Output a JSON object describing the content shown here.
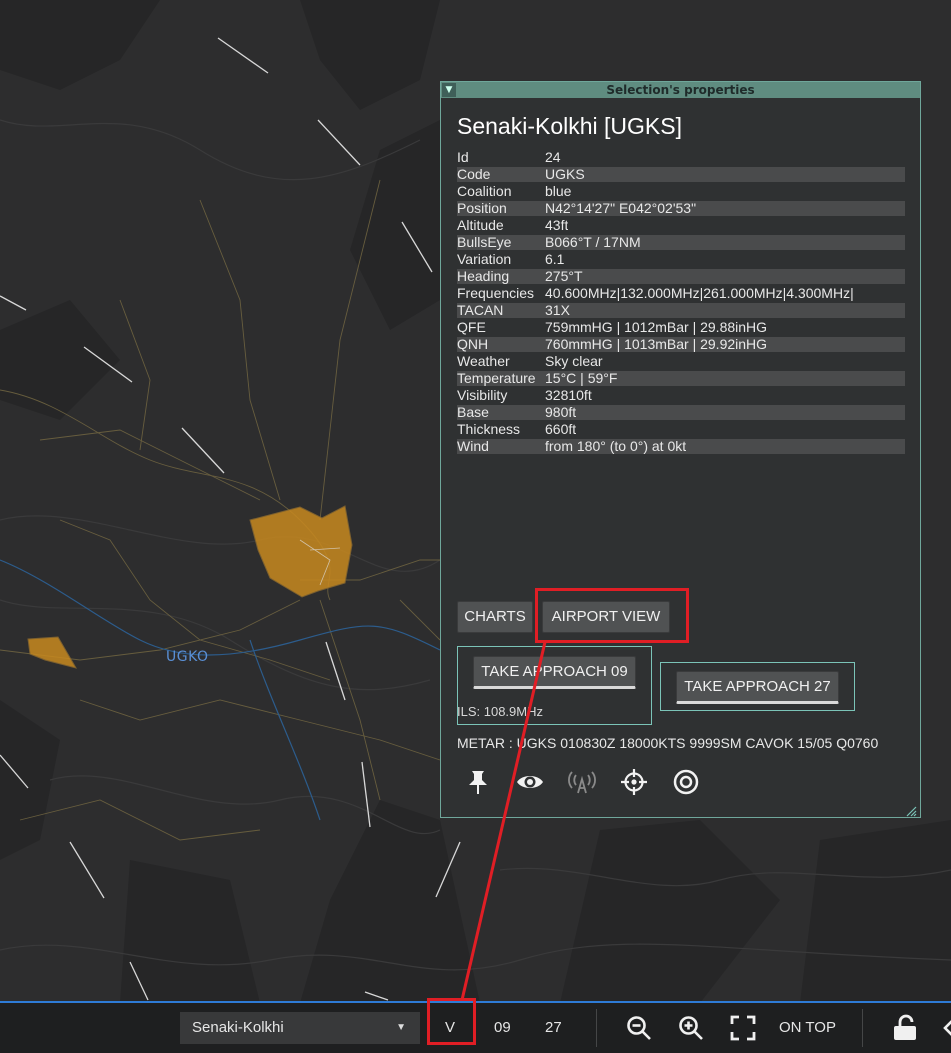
{
  "map": {
    "label": "UGKO"
  },
  "panel": {
    "title": "Selection's properties",
    "airfield_name": "Senaki-Kolkhi [UGKS]",
    "properties": [
      {
        "key": "Id",
        "value": "24"
      },
      {
        "key": "Code",
        "value": "UGKS"
      },
      {
        "key": "Coalition",
        "value": "blue"
      },
      {
        "key": "Position",
        "value": "N42°14'27\" E042°02'53\""
      },
      {
        "key": "Altitude",
        "value": "43ft"
      },
      {
        "key": "BullsEye",
        "value": "B066°T / 17NM"
      },
      {
        "key": "Variation",
        "value": "6.1"
      },
      {
        "key": "Heading",
        "value": "275°T"
      },
      {
        "key": "Frequencies",
        "value": "40.600MHz|132.000MHz|261.000MHz|4.300MHz|"
      },
      {
        "key": "TACAN",
        "value": "31X"
      },
      {
        "key": "QFE",
        "value": "759mmHG | 1012mBar | 29.88inHG"
      },
      {
        "key": "QNH",
        "value": "760mmHG | 1013mBar | 29.92inHG"
      },
      {
        "key": "Weather",
        "value": "Sky clear"
      },
      {
        "key": "Temperature",
        "value": "15°C | 59°F"
      },
      {
        "key": "Visibility",
        "value": "32810ft"
      },
      {
        "key": "Base",
        "value": "980ft"
      },
      {
        "key": "Thickness",
        "value": "660ft"
      },
      {
        "key": "Wind",
        "value": "from 180° (to 0°) at 0kt"
      }
    ],
    "buttons": {
      "charts": "CHARTS",
      "airport_view": "AIRPORT VIEW",
      "approach_09": "TAKE APPROACH 09",
      "approach_27": "TAKE APPROACH 27"
    },
    "ils": "ILS: 108.9MHz",
    "metar": "METAR : UGKS 010830Z 18000KTS 9999SM CAVOK 15/05 Q0760",
    "icons": [
      "pin-icon",
      "eye-icon",
      "radio-tower-icon",
      "crosshair-icon",
      "target-icon"
    ]
  },
  "toolbar": {
    "airfield_select": "Senaki-Kolkhi",
    "view_button": "V",
    "runway_09": "09",
    "runway_27": "27",
    "on_top": "ON TOP",
    "icons": [
      "zoom-out-icon",
      "zoom-in-icon",
      "fullscreen-icon",
      "lock-icon"
    ]
  },
  "colors": {
    "panel_border": "#6fa79b",
    "panel_title_bg": "#5f8c80",
    "highlight": "#e01e25",
    "toolbar_accent": "#2e7bd6",
    "airport_area": "#c8891f"
  }
}
